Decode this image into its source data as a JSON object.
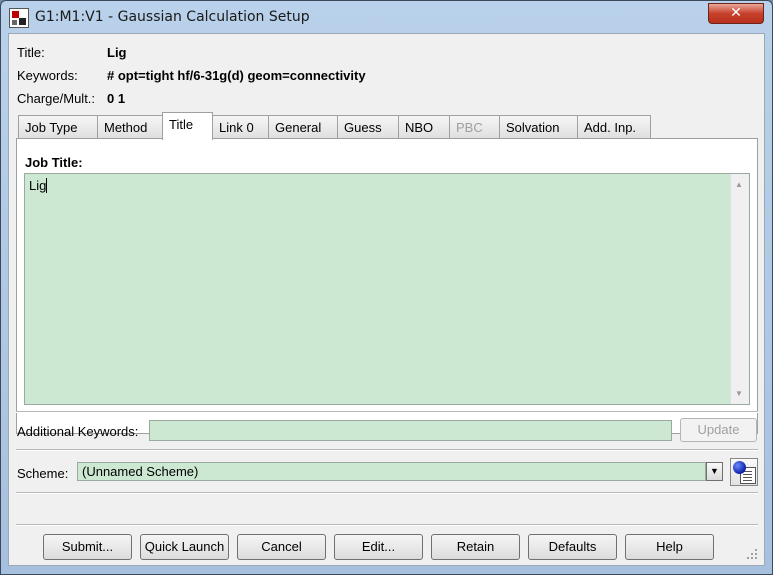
{
  "window": {
    "title": "G1:M1:V1 - Gaussian Calculation Setup",
    "close_glyph": "✕"
  },
  "summary": {
    "title_label": "Title:",
    "title_value": "Lig",
    "keywords_label": "Keywords:",
    "keywords_value": "# opt=tight hf/6-31g(d) geom=connectivity",
    "charge_label": "Charge/Mult.:",
    "charge_value": "0 1"
  },
  "tabs": [
    {
      "label": "Job Type",
      "active": false,
      "enabled": true
    },
    {
      "label": "Method",
      "active": false,
      "enabled": true
    },
    {
      "label": "Title",
      "active": true,
      "enabled": true
    },
    {
      "label": "Link 0",
      "active": false,
      "enabled": true
    },
    {
      "label": "General",
      "active": false,
      "enabled": true
    },
    {
      "label": "Guess",
      "active": false,
      "enabled": true
    },
    {
      "label": "NBO",
      "active": false,
      "enabled": true
    },
    {
      "label": "PBC",
      "active": false,
      "enabled": false
    },
    {
      "label": "Solvation",
      "active": false,
      "enabled": true
    },
    {
      "label": "Add. Inp.",
      "active": false,
      "enabled": true
    }
  ],
  "title_panel": {
    "heading": "Job Title:",
    "text": "Lig"
  },
  "additional_keywords": {
    "label": "Additional Keywords:",
    "value": "",
    "update_label": "Update",
    "update_enabled": false
  },
  "scheme": {
    "label": "Scheme:",
    "value": "(Unnamed Scheme)"
  },
  "buttons": {
    "submit": "Submit...",
    "quick_launch": "Quick Launch",
    "cancel": "Cancel",
    "edit": "Edit...",
    "retain": "Retain",
    "defaults": "Defaults",
    "help": "Help"
  },
  "icons": {
    "close": "close-icon",
    "dropdown": "chevron-down-icon",
    "scheme": "scheme-edit-icon",
    "resize": "resize-grip-icon"
  },
  "colors": {
    "field_bg": "#cde8d2",
    "close_button": "#c7412c"
  }
}
